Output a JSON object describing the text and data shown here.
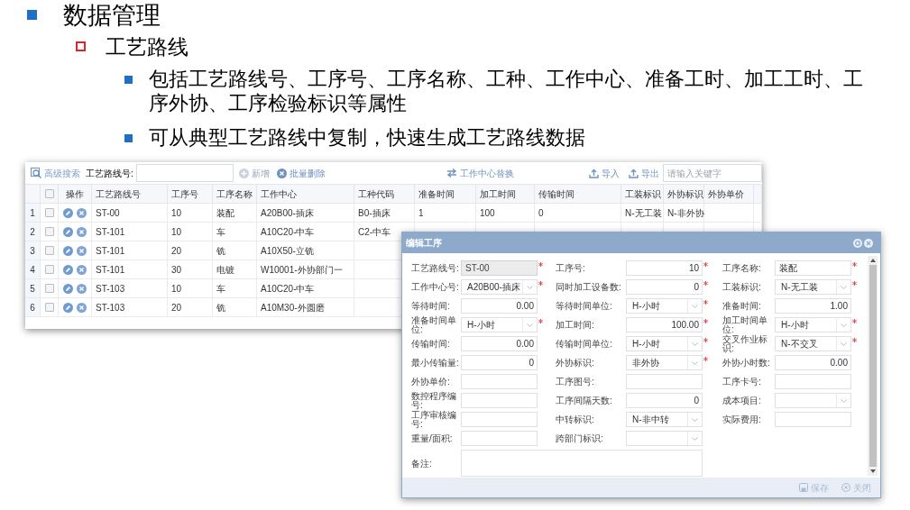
{
  "slide": {
    "bullets": [
      {
        "text": "数据管理",
        "children": [
          {
            "text": "工艺路线",
            "children": [
              {
                "text": "包括工艺路线号、工序号、工序名称、工种、工作中心、准备工时、加工工时、工序外协、工序检验标识等属性"
              },
              {
                "text": "可从典型工艺路线中复制，快速生成工艺路线数据"
              }
            ]
          }
        ]
      }
    ]
  },
  "table_window": {
    "toolbar": {
      "advanced_search": "高级搜索",
      "route_label": "工艺路线号:",
      "add_button": {
        "label": "新增",
        "disabled": true
      },
      "batch_delete_button": {
        "label": "批量删除",
        "disabled": false
      },
      "replace_button": "工作中心替换",
      "import_button": "导入",
      "export_button": "导出",
      "search_placeholder": "请输入关键字"
    },
    "header_checked": false,
    "columns": [
      "操作",
      "工艺路线号",
      "工序号",
      "工序名称",
      "工作中心",
      "工种代码",
      "准备时间",
      "加工时间",
      "传输时间",
      "工装标识",
      "外协标识",
      "外协单价"
    ],
    "rows": [
      {
        "number": "1",
        "checked": false,
        "route_no": "ST-00",
        "op_no": "10",
        "op_name": "装配",
        "work_center": "A20B00-插床",
        "trade_code": "B0-插床",
        "prep_time": "1",
        "proc_time": "100",
        "transfer_time": "0",
        "tooling": "N-无工装",
        "outsourcing": "N-非外协"
      },
      {
        "number": "2",
        "checked": false,
        "route_no": "ST-101",
        "op_no": "10",
        "op_name": "车",
        "work_center": "A10C20-中车",
        "trade_code": "C2-中车"
      },
      {
        "number": "3",
        "checked": false,
        "route_no": "ST-101",
        "op_no": "20",
        "op_name": "铣",
        "work_center": "A10X50-立铣"
      },
      {
        "number": "4",
        "checked": false,
        "route_no": "ST-101",
        "op_no": "30",
        "op_name": "电镀",
        "work_center": "W10001-外协部门一"
      },
      {
        "number": "5",
        "checked": false,
        "route_no": "ST-103",
        "op_no": "10",
        "op_name": "车",
        "work_center": "A10C20-中车"
      },
      {
        "number": "6",
        "checked": false,
        "route_no": "ST-103",
        "op_no": "20",
        "op_name": "铣",
        "work_center": "A10M30-外圆磨"
      }
    ]
  },
  "dialog": {
    "title": "编辑工序",
    "rows": [
      [
        {
          "label": "工艺路线号:",
          "value": "ST-00",
          "kind": "readonly",
          "required": true
        },
        {
          "label": "工序号:",
          "value": "10",
          "kind": "number",
          "required": true
        },
        {
          "label": "工序名称:",
          "value": "装配",
          "kind": "text",
          "required": true
        }
      ],
      [
        {
          "label": "工作中心号:",
          "value": "A20B00-插床",
          "kind": "select",
          "required": true
        },
        {
          "label": "同时加工设备数:",
          "value": "0",
          "kind": "number",
          "required": true
        },
        {
          "label": "工装标识:",
          "value": "N-无工装",
          "kind": "select",
          "required": true
        }
      ],
      [
        {
          "label": "等待时间:",
          "value": "0.00",
          "kind": "number",
          "required": false
        },
        {
          "label": "等待时间单位:",
          "value": "H-小时",
          "kind": "select",
          "required": true
        },
        {
          "label": "准备时间:",
          "value": "1.00",
          "kind": "number",
          "required": false
        }
      ],
      [
        {
          "label": "准备时间单位:",
          "value": "H-小时",
          "kind": "select",
          "required": true
        },
        {
          "label": "加工时间:",
          "value": "100.00",
          "kind": "number",
          "required": true
        },
        {
          "label": "加工时间单位:",
          "value": "H-小时",
          "kind": "select",
          "required": true
        }
      ],
      [
        {
          "label": "传输时间:",
          "value": "0.00",
          "kind": "number",
          "required": false
        },
        {
          "label": "传输时间单位:",
          "value": "H-小时",
          "kind": "select",
          "required": true
        },
        {
          "label": "交叉作业标识:",
          "value": "N-不交叉",
          "kind": "select",
          "required": true
        }
      ],
      [
        {
          "label": "最小传输量:",
          "value": "0",
          "kind": "number",
          "required": false
        },
        {
          "label": "外协标识:",
          "value": "非外协",
          "kind": "select",
          "required": true
        },
        {
          "label": "外协小时数:",
          "value": "0.00",
          "kind": "number",
          "required": false
        }
      ],
      [
        {
          "label": "外协单价:",
          "kind": "text",
          "required": false
        },
        {
          "label": "工序图号:",
          "kind": "text",
          "required": false
        },
        {
          "label": "工序卡号:",
          "kind": "text",
          "required": false
        }
      ],
      [
        {
          "label": "数控程序编号:",
          "kind": "text",
          "required": false
        },
        {
          "label": "工序间隔天数:",
          "value": "0",
          "kind": "number",
          "required": false
        },
        {
          "label": "成本项目:",
          "kind": "select",
          "required": false
        }
      ],
      [
        {
          "label": "工序审核编号:",
          "kind": "text",
          "required": false
        },
        {
          "label": "中转标识:",
          "value": "N-非中转",
          "kind": "select",
          "required": false
        },
        {
          "label": "实际费用:",
          "kind": "text",
          "required": false
        }
      ],
      [
        {
          "label": "重量/面积:",
          "kind": "text",
          "required": false
        },
        {
          "label": "跨部门标识:",
          "kind": "select",
          "required": false
        }
      ]
    ],
    "notes_label": "备注:",
    "footer_buttons": [
      {
        "label": "保存",
        "disabled": true
      },
      {
        "label": "关闭",
        "disabled": true
      }
    ]
  }
}
